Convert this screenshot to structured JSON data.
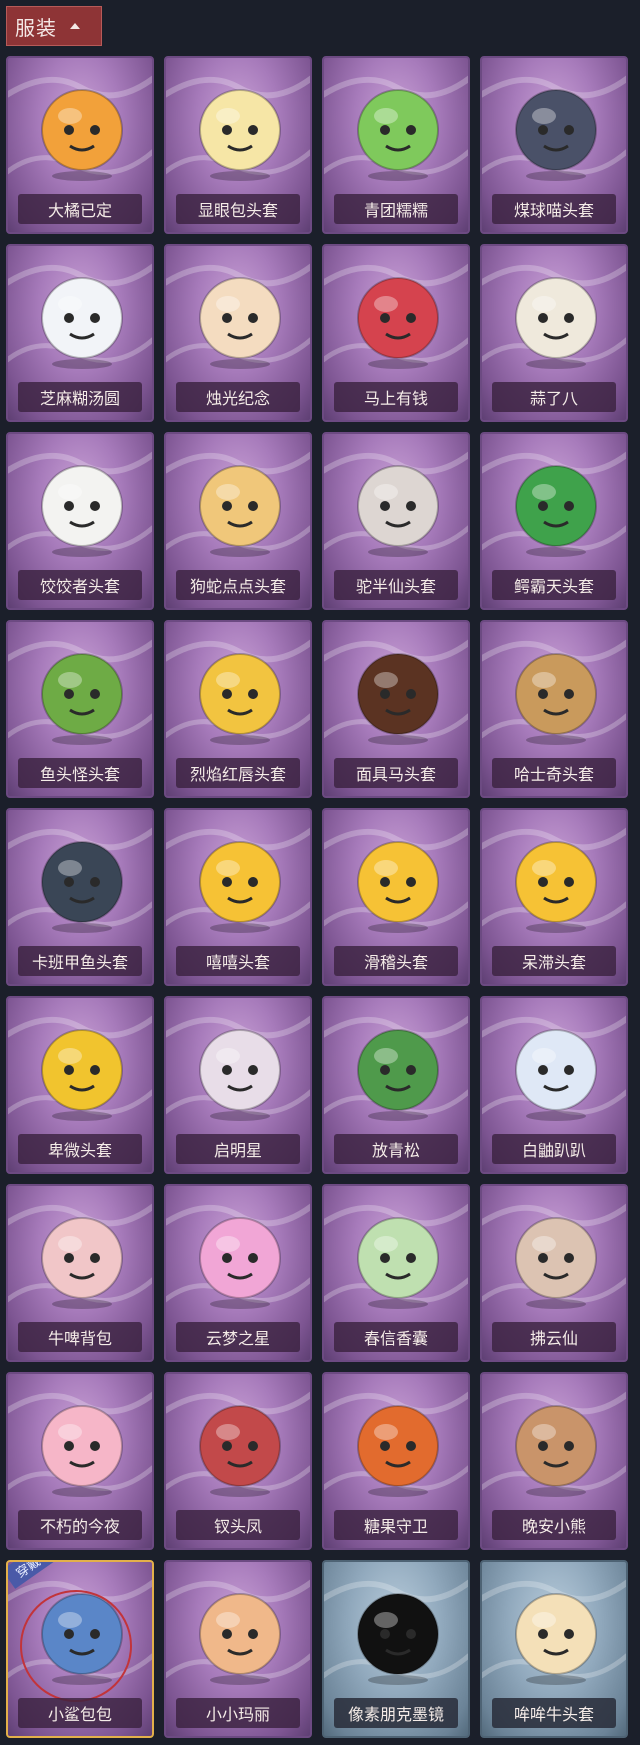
{
  "header": {
    "title": "服装"
  },
  "equipped_label": "穿戴",
  "items": [
    {
      "name": "大橘已定",
      "icon": "orange-face-icon",
      "color": "#f2a13a",
      "variant": "purple"
    },
    {
      "name": "显眼包头套",
      "icon": "lightbulb-face-icon",
      "color": "#f6e6a6",
      "variant": "purple"
    },
    {
      "name": "青团糯糯",
      "icon": "green-dumpling-icon",
      "color": "#7fc95c",
      "variant": "purple"
    },
    {
      "name": "煤球喵头套",
      "icon": "dark-cat-head-icon",
      "color": "#4a5168",
      "variant": "purple"
    },
    {
      "name": "芝麻糊汤圆",
      "icon": "rice-ball-icon",
      "color": "#f2f4f8",
      "variant": "purple"
    },
    {
      "name": "烛光纪念",
      "icon": "candle-icon",
      "color": "#f4dcc0",
      "variant": "purple"
    },
    {
      "name": "马上有钱",
      "icon": "red-horse-icon",
      "color": "#d5434e",
      "variant": "purple"
    },
    {
      "name": "蒜了八",
      "icon": "garlic-icon",
      "color": "#efe9dc",
      "variant": "purple"
    },
    {
      "name": "饺饺者头套",
      "icon": "dumpling-head-icon",
      "color": "#f3f3f1",
      "variant": "purple"
    },
    {
      "name": "狗蛇点点头套",
      "icon": "snake-head-icon",
      "color": "#f0c77a",
      "variant": "purple"
    },
    {
      "name": "驼半仙头套",
      "icon": "raccoon-head-icon",
      "color": "#ddd6d2",
      "variant": "purple"
    },
    {
      "name": "鳄霸天头套",
      "icon": "crocodile-head-icon",
      "color": "#3fa24b",
      "variant": "purple"
    },
    {
      "name": "鱼头怪头套",
      "icon": "fish-head-icon",
      "color": "#6eab45",
      "variant": "purple"
    },
    {
      "name": "烈焰红唇头套",
      "icon": "pikachu-mask-icon",
      "color": "#f2c440",
      "variant": "purple"
    },
    {
      "name": "面具马头套",
      "icon": "horse-mask-icon",
      "color": "#5b3322",
      "variant": "purple"
    },
    {
      "name": "哈士奇头套",
      "icon": "dog-head-icon",
      "color": "#c99a5c",
      "variant": "purple"
    },
    {
      "name": "卡班甲鱼头套",
      "icon": "turtle-head-icon",
      "color": "#3a4656",
      "variant": "purple"
    },
    {
      "name": "嘻嘻头套",
      "icon": "grin-emoji-icon",
      "color": "#f6c235",
      "variant": "purple"
    },
    {
      "name": "滑稽头套",
      "icon": "sly-emoji-icon",
      "color": "#f6c235",
      "variant": "purple"
    },
    {
      "name": "呆滞头套",
      "icon": "dazed-emoji-icon",
      "color": "#f6c235",
      "variant": "purple"
    },
    {
      "name": "卑微头套",
      "icon": "humble-emoji-icon",
      "color": "#f1c42e",
      "variant": "purple"
    },
    {
      "name": "启明星",
      "icon": "pale-figure-icon",
      "color": "#e8dde8",
      "variant": "purple"
    },
    {
      "name": "放青松",
      "icon": "potted-pine-icon",
      "color": "#4f9a4b",
      "variant": "purple"
    },
    {
      "name": "白鼬趴趴",
      "icon": "white-weasel-icon",
      "color": "#dfe8f6",
      "variant": "purple"
    },
    {
      "name": "牛啤背包",
      "icon": "cow-beer-icon",
      "color": "#f1c6c8",
      "variant": "purple"
    },
    {
      "name": "云梦之星",
      "icon": "unicorn-cloud-icon",
      "color": "#f1a6d6",
      "variant": "purple"
    },
    {
      "name": "春信香囊",
      "icon": "sachet-icon",
      "color": "#bfe0b0",
      "variant": "purple"
    },
    {
      "name": "拂云仙",
      "icon": "hanging-ornament-icon",
      "color": "#dcc3b2",
      "variant": "purple"
    },
    {
      "name": "不朽的今夜",
      "icon": "pink-cat-bowl-icon",
      "color": "#f6b6c8",
      "variant": "purple"
    },
    {
      "name": "钗头凤",
      "icon": "phoenix-crown-icon",
      "color": "#c2494a",
      "variant": "purple"
    },
    {
      "name": "糖果守卫",
      "icon": "pumpkin-guard-icon",
      "color": "#e26b2e",
      "variant": "purple"
    },
    {
      "name": "晚安小熊",
      "icon": "teddy-bear-icon",
      "color": "#c9946a",
      "variant": "purple"
    },
    {
      "name": "小鲨包包",
      "icon": "shark-bag-icon",
      "color": "#5a86c8",
      "variant": "purple",
      "equipped": true
    },
    {
      "name": "小小玛丽",
      "icon": "doll-charm-icon",
      "color": "#f0b88a",
      "variant": "purple"
    },
    {
      "name": "像素朋克墨镜",
      "icon": "pixel-sunglasses-icon",
      "color": "#111111",
      "variant": "blue"
    },
    {
      "name": "哞哞牛头套",
      "icon": "cow-head-icon",
      "color": "#f4e0b8",
      "variant": "blue"
    }
  ]
}
